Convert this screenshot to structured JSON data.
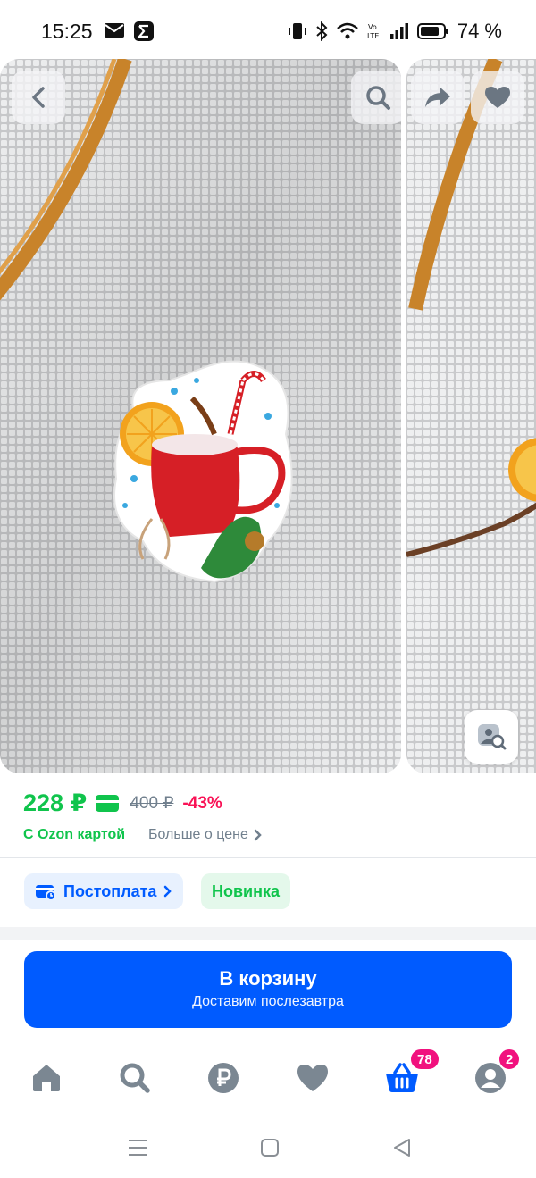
{
  "status_bar": {
    "time": "15:25",
    "battery": "74 %",
    "left_icons": [
      "mail-icon",
      "sigma-app-icon"
    ],
    "right_icons": [
      "vibrate-icon",
      "bluetooth-icon",
      "wifi-icon",
      "volte-icon",
      "signal-icon",
      "battery-icon"
    ]
  },
  "gallery": {
    "buttons": [
      "back-icon",
      "search-icon",
      "share-icon",
      "heart-icon",
      "image-search-icon"
    ]
  },
  "price": {
    "current": "228 ₽",
    "old": "400 ₽",
    "discount": "-43%",
    "card_label": "С Ozon картой",
    "more_label": "Больше о цене"
  },
  "chips": {
    "postpay": "Постоплата",
    "new": "Новинка"
  },
  "cart": {
    "title": "В корзину",
    "subtitle": "Доставим послезавтра"
  },
  "bottom_nav": {
    "items": [
      "home-icon",
      "search-icon",
      "ruble-icon",
      "heart-icon",
      "basket-icon",
      "profile-icon"
    ],
    "basket_badge": "78",
    "profile_badge": "2"
  },
  "colors": {
    "brand_blue": "#005bff",
    "price_green": "#10c44c",
    "discount_pink": "#f91155",
    "badge_magenta": "#f1117e"
  }
}
